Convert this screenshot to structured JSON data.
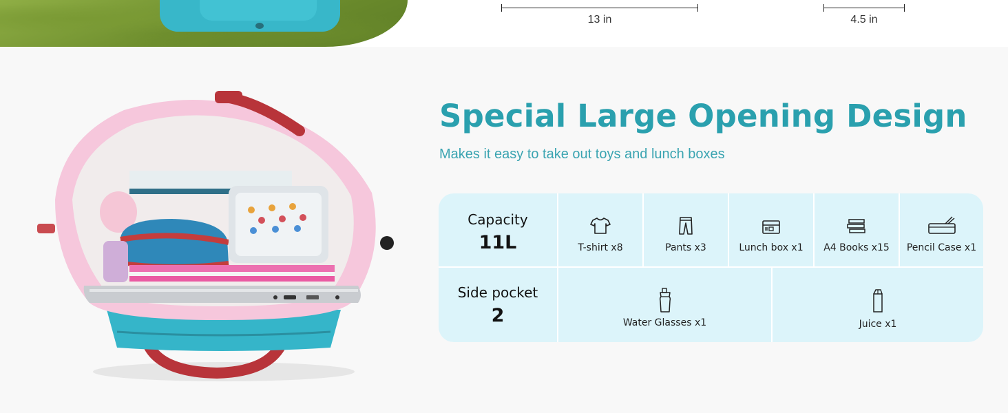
{
  "dimensions": {
    "width_label": "13 in",
    "depth_label": "4.5 in"
  },
  "heading": {
    "title": "Special Large Opening Design",
    "subtitle": "Makes it easy to take out toys and lunch boxes",
    "accent_color": "#2aa0ae"
  },
  "capacity_table": {
    "cell_color": "#dcf4fa",
    "capacity": {
      "label": "Capacity",
      "value": "11L",
      "items": [
        {
          "icon": "t-shirt-icon",
          "label": "T-shirt x8"
        },
        {
          "icon": "pants-icon",
          "label": "Pants x3"
        },
        {
          "icon": "lunch-box-icon",
          "label": "Lunch box x1"
        },
        {
          "icon": "books-icon",
          "label": "A4 Books x15"
        },
        {
          "icon": "pencil-case-icon",
          "label": "Pencil Case x1"
        }
      ]
    },
    "side_pocket": {
      "label": "Side pocket",
      "value": "2",
      "items": [
        {
          "icon": "water-bottle-icon",
          "label": "Water Glasses x1"
        },
        {
          "icon": "juice-box-icon",
          "label": "Juice x1"
        }
      ]
    }
  }
}
